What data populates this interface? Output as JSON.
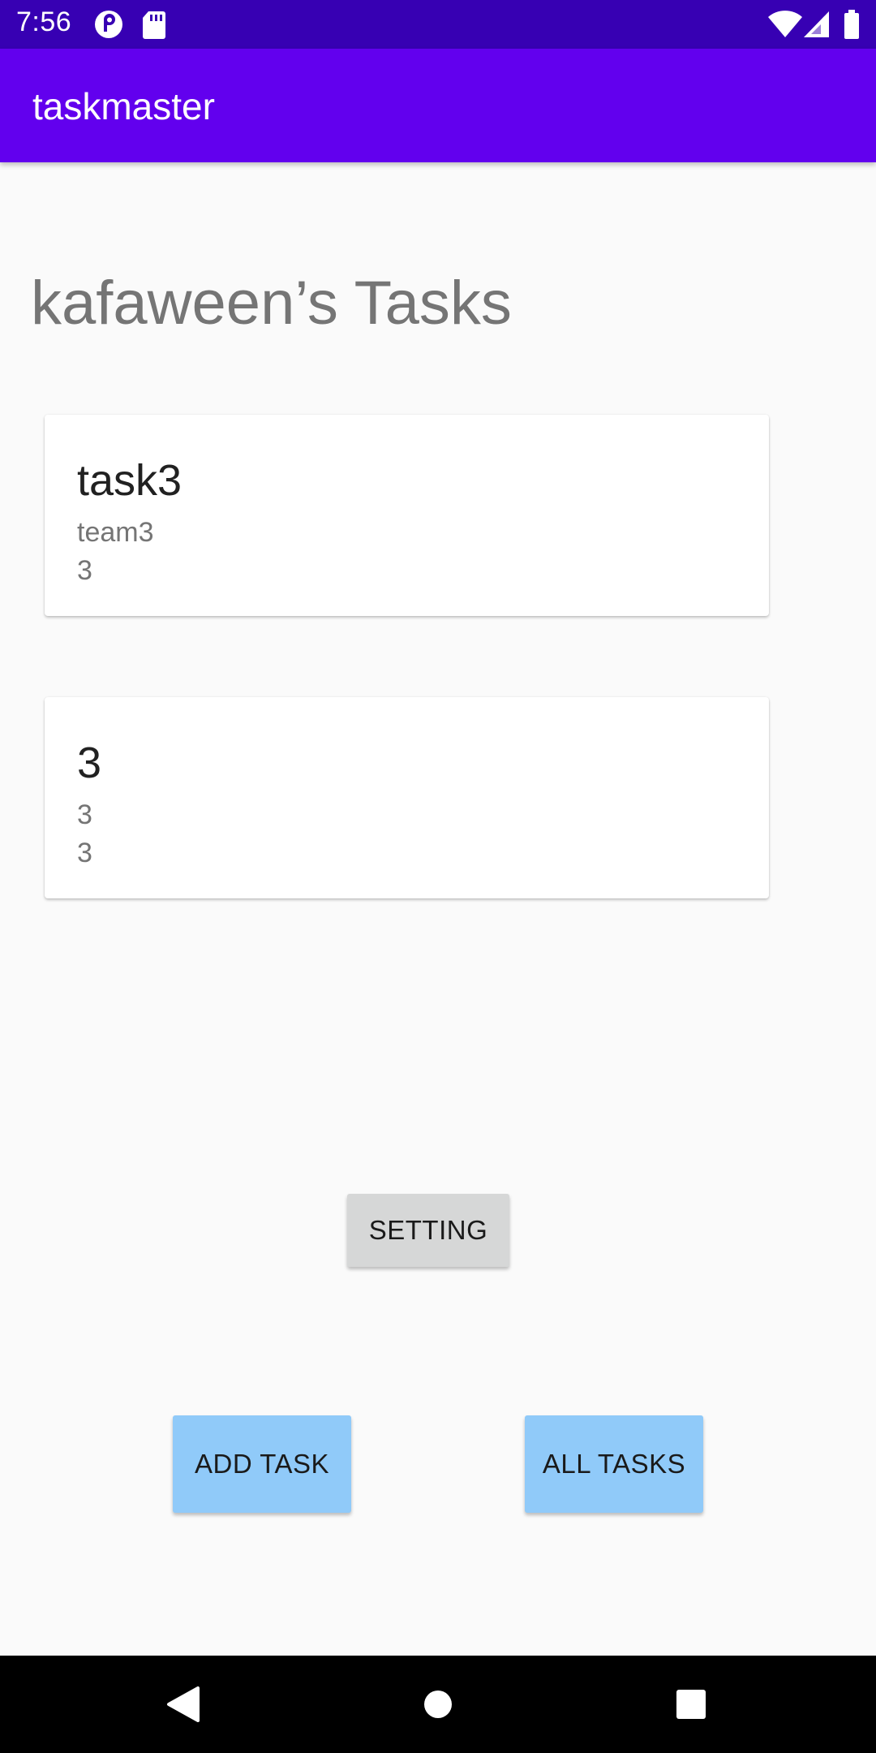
{
  "status_bar": {
    "time": "7:56",
    "icons": [
      "pocket-casts-icon",
      "sd-card-icon",
      "wifi-icon",
      "signal-icon",
      "battery-icon"
    ]
  },
  "app_bar": {
    "title": "taskmaster",
    "color": "#6200ee"
  },
  "main": {
    "heading": "kafaween’s Tasks",
    "tasks": [
      {
        "title": "task3",
        "line1": "team3",
        "line2": "3"
      },
      {
        "title": "3",
        "line1": "3",
        "line2": "3"
      }
    ]
  },
  "buttons": {
    "setting_label": "SETTING",
    "add_task_label": "ADD TASK",
    "all_tasks_label": "ALL TASKS",
    "accent_color": "#90caf9"
  },
  "nav_bar": {
    "icons": [
      "back-icon",
      "home-icon",
      "recents-icon"
    ]
  }
}
